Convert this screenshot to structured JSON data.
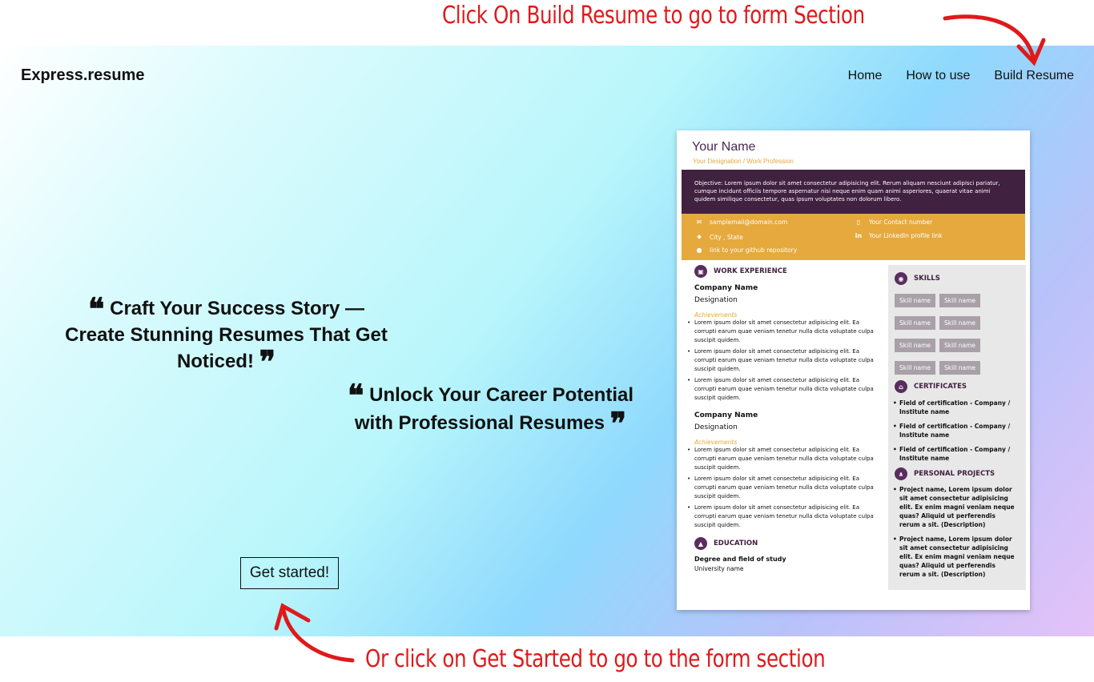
{
  "annotations": {
    "top": "Click On Build Resume to go to form Section",
    "bottom": "Or click on Get Started to go to the form section",
    "color": "#e0191b"
  },
  "navbar": {
    "brand": "Express.resume",
    "links": [
      "Home",
      "How to use",
      "Build Resume"
    ]
  },
  "hero": {
    "quote1": "Craft Your Success Story — Create Stunning Resumes That Get Noticed!",
    "quote2": "Unlock Your Career Potential with Professional Resumes",
    "cta": "Get started!"
  },
  "resume": {
    "name": "Your Name",
    "designation": "Your Designation / Work Profession",
    "objective": "Objective: Lorem ipsum dolor sit amet consectetur adipisicing elit. Rerum aliquam nesciunt adipisci pariatur, cumque incidunt officiis tempore aspernatur nisi neque enim quam animi asperiores, quaerat vitae animi quidem similique consectetur, quas ipsum voluptates non dolorum libero.",
    "contact": {
      "email": "samplemail@domain.com",
      "phone": "Your Contact number",
      "location": "City , State",
      "linkedin": "Your LinkedIn profile link",
      "github": "link to your github repository"
    },
    "work": {
      "heading": "WORK EXPERIENCE",
      "company": "Company Name",
      "designation": "Designation",
      "achievements_label": "Achievements",
      "bullet": "Lorem ipsum dolor sit amet consectetur adipisicing elit. Ea corrupti earum quae veniam tenetur nulla dicta voluptate culpa suscipit quidem."
    },
    "education": {
      "heading": "EDUCATION",
      "degree": "Degree and field of study",
      "university": "University name"
    },
    "skills": {
      "heading": "SKILLS",
      "items": [
        "Skill name",
        "Skill name",
        "Skill name",
        "Skill name",
        "Skill name",
        "Skill name",
        "Skill name",
        "Skill name"
      ]
    },
    "certificates": {
      "heading": "CERTIFICATES",
      "items": [
        "Field of certification - Company / Institute name",
        "Field of certification - Company / Institute name",
        "Field of certification - Company / Institute name"
      ]
    },
    "projects": {
      "heading": "PERSONAL PROJECTS",
      "items": [
        "Project name, Lorem ipsum dolor sit amet consectetur adipisicing elit. Ex enim magni veniam neque quas? Aliquid ut perferendis rerum a sit. (Description)",
        "Project name, Lorem ipsum dolor sit amet consectetur adipisicing elit. Ex enim magni veniam neque quas? Aliquid ut perferendis rerum a sit. (Description)"
      ]
    },
    "colors": {
      "primary": "#402140",
      "accent": "#e5a93d",
      "sidebar": "#e8e8e8"
    }
  }
}
